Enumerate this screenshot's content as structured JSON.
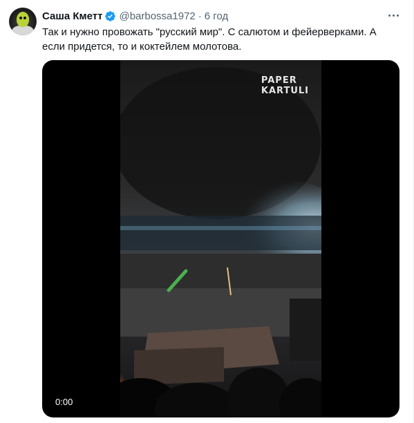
{
  "tweet": {
    "author_name": "Саша Кметт",
    "handle": "@barbossa1972",
    "separator": "·",
    "time": "6 год",
    "text": "Так и нужно провожать \"русский мир\". С салютом и фейерверками. А если придется, то и коктейлем молотова."
  },
  "media": {
    "watermark_line1": "PAPER",
    "watermark_line2": "KARTULI",
    "timestamp": "0:00"
  },
  "colors": {
    "text_primary": "#0f1419",
    "text_secondary": "#536471",
    "verified": "#1d9bf0"
  },
  "icons": {
    "verified": "verified-badge-icon",
    "more": "more-dots-icon"
  }
}
